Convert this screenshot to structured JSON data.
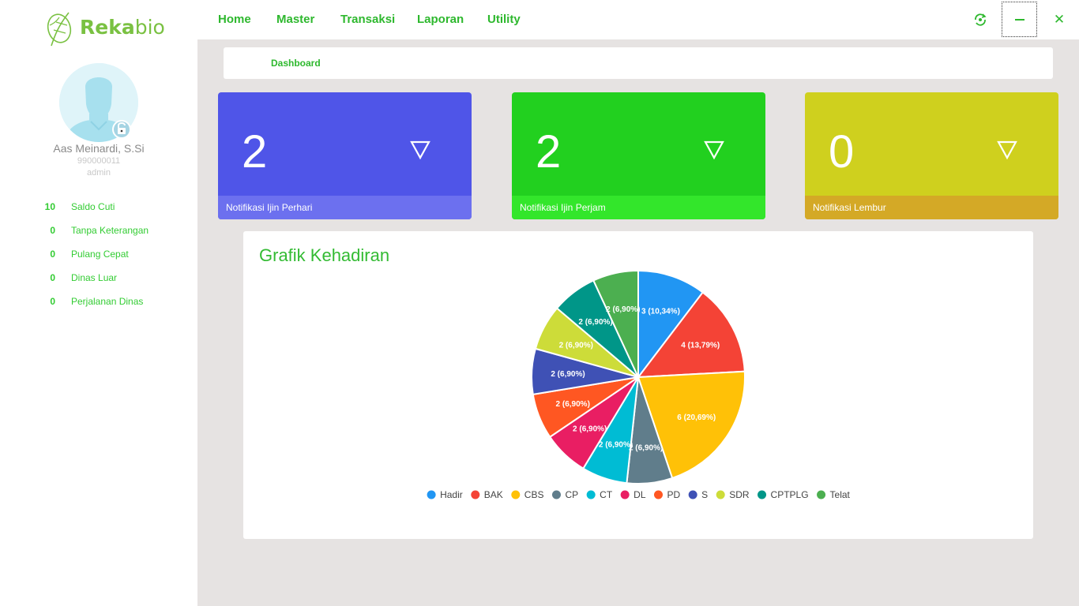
{
  "app": {
    "logo_bold": "Reka",
    "logo_light": "bio"
  },
  "user": {
    "name": "Aas Meinardi, S.Si",
    "id": "990000011",
    "role": "admin"
  },
  "stats": [
    {
      "count": "10",
      "label": "Saldo Cuti"
    },
    {
      "count": "0",
      "label": "Tanpa Keterangan"
    },
    {
      "count": "0",
      "label": "Pulang Cepat"
    },
    {
      "count": "0",
      "label": "Dinas Luar"
    },
    {
      "count": "0",
      "label": "Perjalanan Dinas"
    }
  ],
  "nav": {
    "items": [
      "Home",
      "Master",
      "Transaksi",
      "Laporan",
      "Utility"
    ]
  },
  "breadcrumb": "Dashboard",
  "cards": [
    {
      "value": "2",
      "label": "Notifikasi Ijin Perhari",
      "color": "#4f55e8",
      "footer_color": "#6c70ef"
    },
    {
      "value": "2",
      "label": "Notifikasi Ijin Perjam",
      "color": "#22d01f",
      "footer_color": "#33e62b"
    },
    {
      "value": "0",
      "label": "Notifikasi Lembur",
      "color": "#cfd01e",
      "footer_color": "#d4a926"
    }
  ],
  "icons": {
    "refresh": "refresh-icon",
    "minimize": "minimize-icon",
    "close": "close-icon",
    "card_arrow": "chevron-down-icon"
  },
  "chart_title": "Grafik Kehadiran",
  "chart_data": {
    "type": "pie",
    "categories": [
      "Hadir",
      "BAK",
      "CBS",
      "CP",
      "CT",
      "DL",
      "PD",
      "S",
      "SDR",
      "CPTPLG",
      "Telat"
    ],
    "values": [
      3,
      4,
      6,
      2,
      2,
      2,
      2,
      2,
      2,
      2,
      2
    ],
    "data_labels": [
      "3 (10,34%)",
      "4 (13,79%)",
      "6 (20,69%)",
      "2 (6,90%)",
      "2 (6,90%)",
      "2 (6,90%)",
      "2 (6,90%)",
      "2 (6,90%)",
      "2 (6,90%)",
      "2 (6,90%)",
      "2 (6,90%)"
    ],
    "colors": [
      "#2196f3",
      "#f44336",
      "#ffc107",
      "#607d8b",
      "#00bcd4",
      "#e91e63",
      "#ff5722",
      "#3f51b5",
      "#cddc39",
      "#009688",
      "#4caf50"
    ],
    "legend": "bottom"
  },
  "close_glyph": "✕"
}
